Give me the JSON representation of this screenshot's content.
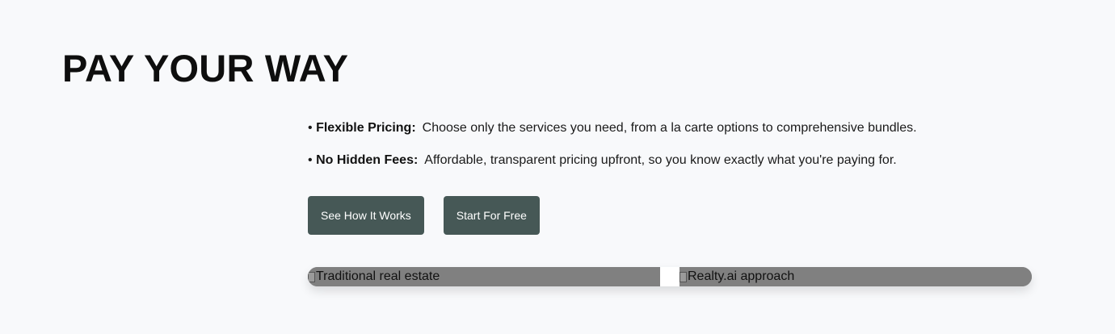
{
  "heading": "PAY YOUR WAY",
  "bullets": [
    {
      "marker": "•",
      "title": "Flexible Pricing:",
      "text": "Choose only the services you need, from a la carte options to comprehensive bundles."
    },
    {
      "marker": "•",
      "title": "No Hidden Fees:",
      "text": "Affordable, transparent pricing upfront, so you know exactly what you're paying for."
    }
  ],
  "buttons": {
    "how_it_works": "See How It Works",
    "start_free": "Start For Free"
  },
  "comparison": {
    "left_alt": "Traditional real estate",
    "right_alt": "Realty.ai approach",
    "left_icon": "broken-image-icon",
    "right_icon": "broken-image-icon"
  },
  "colors": {
    "background": "#f8f9fb",
    "button": "#465856",
    "image_placeholder": "#808080"
  }
}
